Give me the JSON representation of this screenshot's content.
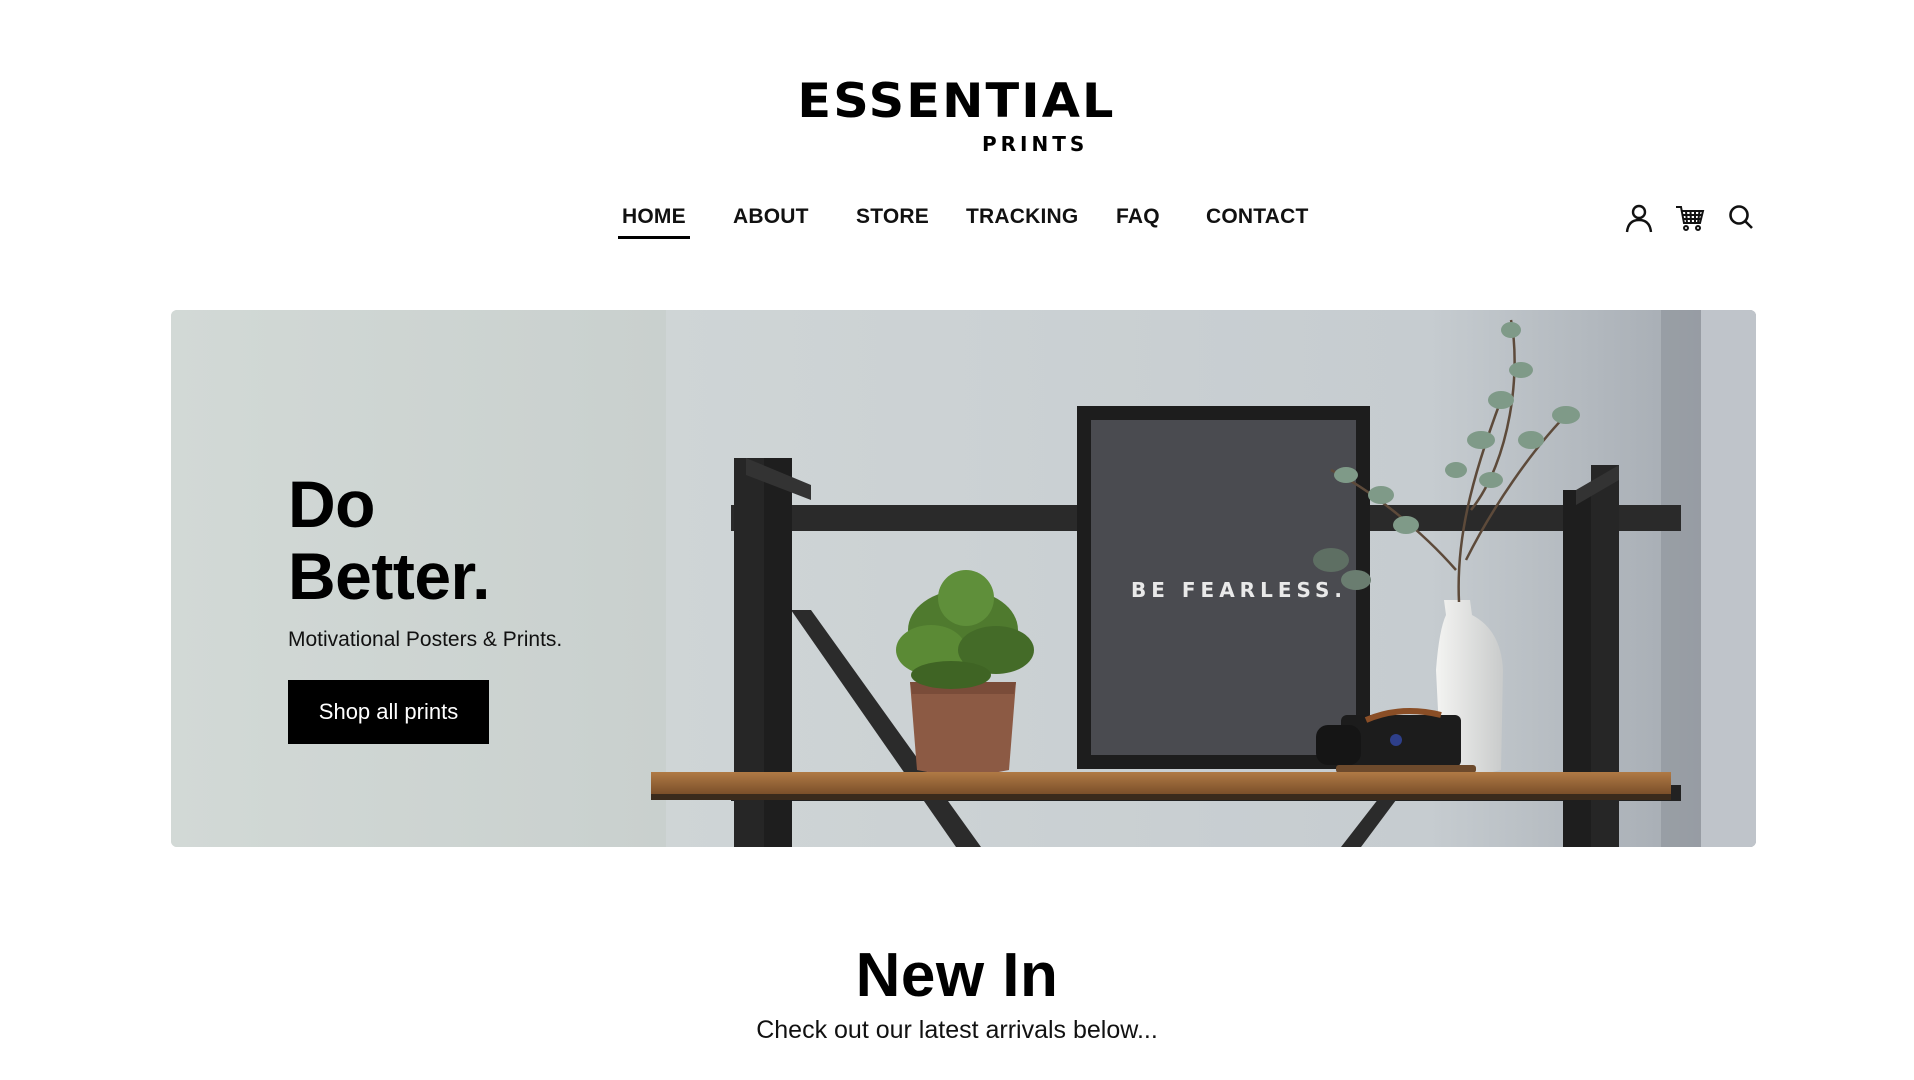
{
  "brand": {
    "name": "ESSENTIAL",
    "tagline": "PRINTS"
  },
  "nav": {
    "items": [
      {
        "label": "HOME",
        "active": true
      },
      {
        "label": "ABOUT",
        "active": false
      },
      {
        "label": "STORE",
        "active": false
      },
      {
        "label": "TRACKING",
        "active": false
      },
      {
        "label": "FAQ",
        "active": false
      },
      {
        "label": "CONTACT",
        "active": false
      }
    ]
  },
  "header_icons": [
    "account-icon",
    "cart-icon",
    "search-icon"
  ],
  "hero": {
    "title_line1": "Do",
    "title_line2": "Better.",
    "subtitle": "Motivational Posters & Prints.",
    "cta_label": "Shop all prints",
    "poster_text": "BE FEARLESS."
  },
  "new_in": {
    "title": "New In",
    "subtitle": "Check out our latest arrivals below..."
  },
  "colors": {
    "accent": "#000000",
    "hero_background": "#d3dbd8",
    "page_background": "#ffffff"
  }
}
